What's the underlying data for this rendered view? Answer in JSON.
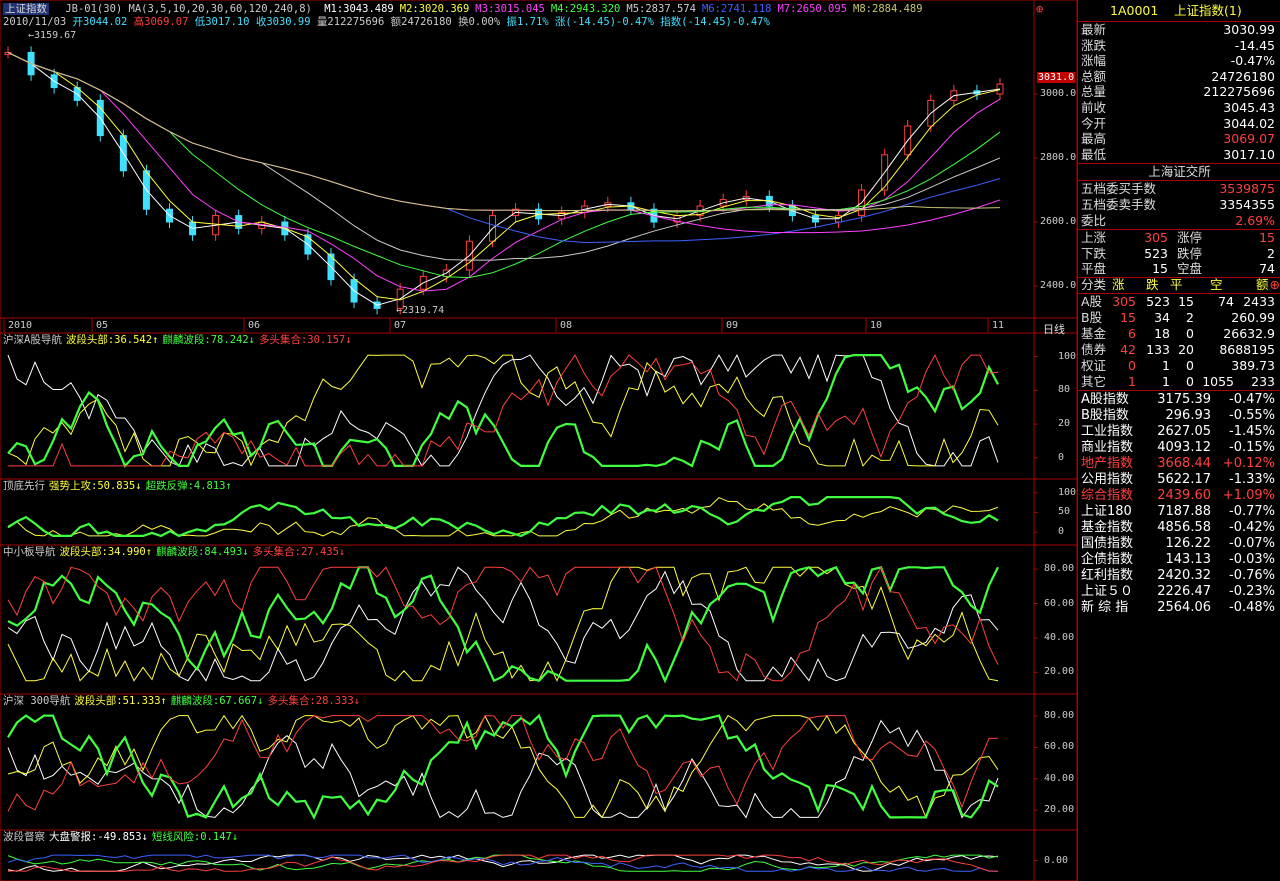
{
  "window": {
    "title_left": "上证指数",
    "indicator_line": "JB-01(30) MA(3,5,10,20,30,60,120,240,8)",
    "ma_values": [
      {
        "label": "M1:3043.489",
        "color": "#ffffff"
      },
      {
        "label": "M2:3020.369",
        "color": "#ffff40"
      },
      {
        "label": "M3:3015.045",
        "color": "#ff40ff"
      },
      {
        "label": "M4:2943.320",
        "color": "#40ff40"
      },
      {
        "label": "M5:2837.574",
        "color": "#cccccc"
      },
      {
        "label": "M6:2741.118",
        "color": "#4060ff"
      },
      {
        "label": "M7:2650.095",
        "color": "#ff40ff"
      },
      {
        "label": "M8:2884.489",
        "color": "#c8c870"
      }
    ],
    "date": "2010/11/03",
    "ohlc": {
      "open": "开3044.02",
      "high": "高3069.07",
      "low": "低3017.10",
      "close": "收3030.99",
      "vol": "量212275696",
      "amount": "额24726180",
      "turnover": "换0.00%",
      "amplitude": "振1.71%",
      "change": "涨(-14.45)-0.47%",
      "index_change": "指数(-14.45)-0.47%"
    },
    "high_label": "3159.67",
    "low_label": "2319.74",
    "current_price_tag": "3031.0",
    "period_label": "日线"
  },
  "price_axis": [
    "3000.0",
    "2800.0",
    "2600.0",
    "2400.0"
  ],
  "time_axis": [
    "2010",
    "05",
    "06",
    "07",
    "08",
    "09",
    "10",
    "11"
  ],
  "panels": [
    {
      "name": "沪深A股导航",
      "items": [
        {
          "t": "波段头部:36.542↑",
          "c": "#ffff40"
        },
        {
          "t": "麒麟波段:78.242↓",
          "c": "#40ff40"
        },
        {
          "t": "多头集合:30.157↓",
          "c": "#ff4040"
        }
      ],
      "axis": [
        "100",
        "80",
        "20",
        "0"
      ]
    },
    {
      "name": "顶底先行",
      "items": [
        {
          "t": "强势上攻:50.835↓",
          "c": "#ffff40"
        },
        {
          "t": "超跌反弹:4.813↑",
          "c": "#40ff40"
        }
      ],
      "axis": [
        "100",
        "50",
        "0"
      ]
    },
    {
      "name": "中小板导航",
      "items": [
        {
          "t": "波段头部:34.990↑",
          "c": "#ffff40"
        },
        {
          "t": "麒麟波段:84.493↓",
          "c": "#40ff40"
        },
        {
          "t": "多头集合:27.435↓",
          "c": "#ff4040"
        }
      ],
      "axis": [
        "80.00",
        "60.00",
        "40.00",
        "20.00"
      ]
    },
    {
      "name": "沪深 300导航",
      "items": [
        {
          "t": "波段头部:51.333↑",
          "c": "#ffff40"
        },
        {
          "t": "麒麟波段:67.667↓",
          "c": "#40ff40"
        },
        {
          "t": "多头集合:28.333↓",
          "c": "#ff4040"
        }
      ],
      "axis": [
        "80.00",
        "60.00",
        "40.00",
        "20.00"
      ]
    },
    {
      "name": "波段督察",
      "items": [
        {
          "t": "大盘警报:-49.853↓",
          "c": "#ffffff"
        },
        {
          "t": "短线风险:0.147↓",
          "c": "#40ff40"
        }
      ],
      "axis": [
        "0.00"
      ]
    }
  ],
  "quote": {
    "code": "1A0001",
    "name": "上证指数(1)",
    "rows": [
      {
        "k": "最新",
        "v": "3030.99",
        "c": "wht"
      },
      {
        "k": "涨跌",
        "v": "-14.45",
        "c": "wht"
      },
      {
        "k": "涨幅",
        "v": "-0.47%",
        "c": "wht"
      },
      {
        "k": "总额",
        "v": "24726180",
        "c": "wht"
      },
      {
        "k": "总量",
        "v": "212275696",
        "c": "wht"
      },
      {
        "k": "前收",
        "v": "3045.43",
        "c": "wht"
      },
      {
        "k": "今开",
        "v": "3044.02",
        "c": "wht"
      },
      {
        "k": "最高",
        "v": "3069.07",
        "c": "red"
      },
      {
        "k": "最低",
        "v": "3017.10",
        "c": "wht"
      }
    ],
    "exchange": "上海证交所",
    "order_rows": [
      {
        "k": "五档委买手数",
        "v": "3539875",
        "c": "red"
      },
      {
        "k": "五档委卖手数",
        "v": "3354355",
        "c": "wht"
      },
      {
        "k": "委比",
        "v": "2.69%",
        "c": "red"
      }
    ],
    "breadth": [
      {
        "a": "上涨",
        "av": "305",
        "b": "涨停",
        "bv": "15",
        "ac": "red",
        "bc": "red"
      },
      {
        "a": "下跌",
        "av": "523",
        "b": "跌停",
        "bv": "2",
        "ac": "wht",
        "bc": "wht"
      },
      {
        "a": "平盘",
        "av": "15",
        "b": "空盘",
        "bv": "74",
        "ac": "wht",
        "bc": "wht"
      }
    ],
    "cat_header": [
      "分类",
      "涨",
      "跌",
      "平",
      "空",
      "额"
    ],
    "cat_rows": [
      {
        "n": "A股",
        "u": "305",
        "d": "523",
        "f": "15",
        "e": "74",
        "amt": "2433"
      },
      {
        "n": "B股",
        "u": "15",
        "d": "34",
        "f": "2",
        "e": "",
        "amt": "260.99"
      },
      {
        "n": "基金",
        "u": "6",
        "d": "18",
        "f": "0",
        "e": "",
        "amt": "26632.9"
      },
      {
        "n": "债券",
        "u": "42",
        "d": "133",
        "f": "20",
        "e": "",
        "amt": "8688195"
      },
      {
        "n": "权证",
        "u": "0",
        "d": "1",
        "f": "0",
        "e": "",
        "amt": "389.73"
      },
      {
        "n": "其它",
        "u": "1",
        "d": "1",
        "f": "0",
        "e": "1055",
        "amt": "233"
      }
    ],
    "indices": [
      {
        "n": "A股指数",
        "v": "3175.39",
        "p": "-0.47%",
        "c": "wht"
      },
      {
        "n": "B股指数",
        "v": "296.93",
        "p": "-0.55%",
        "c": "wht"
      },
      {
        "n": "工业指数",
        "v": "2627.05",
        "p": "-1.45%",
        "c": "wht"
      },
      {
        "n": "商业指数",
        "v": "4093.12",
        "p": "-0.15%",
        "c": "wht"
      },
      {
        "n": "地产指数",
        "v": "3668.44",
        "p": "+0.12%",
        "c": "red"
      },
      {
        "n": "公用指数",
        "v": "5622.17",
        "p": "-1.33%",
        "c": "wht"
      },
      {
        "n": "综合指数",
        "v": "2439.60",
        "p": "+1.09%",
        "c": "red"
      },
      {
        "n": "上证180",
        "v": "7187.88",
        "p": "-0.77%",
        "c": "wht"
      },
      {
        "n": "基金指数",
        "v": "4856.58",
        "p": "-0.42%",
        "c": "wht"
      },
      {
        "n": "国债指数",
        "v": "126.22",
        "p": "-0.07%",
        "c": "wht"
      },
      {
        "n": "企债指数",
        "v": "143.13",
        "p": "-0.03%",
        "c": "wht"
      },
      {
        "n": "红利指数",
        "v": "2420.32",
        "p": "-0.76%",
        "c": "wht"
      },
      {
        "n": "上证５０",
        "v": "2226.47",
        "p": "-0.23%",
        "c": "wht"
      },
      {
        "n": "新 综 指",
        "v": "2564.06",
        "p": "-0.48%",
        "c": "wht"
      }
    ]
  },
  "chart_data": {
    "type": "line",
    "title": "上证指数",
    "x": [
      "2010",
      "05",
      "06",
      "07",
      "08",
      "09",
      "10",
      "11"
    ],
    "close_series": [
      3130,
      3060,
      3020,
      2980,
      2870,
      2760,
      2640,
      2600,
      2560,
      2620,
      2580,
      2600,
      2560,
      2500,
      2420,
      2350,
      2330,
      2390,
      2430,
      2450,
      2540,
      2620,
      2640,
      2610,
      2630,
      2650,
      2660,
      2640,
      2600,
      2620,
      2650,
      2670,
      2680,
      2650,
      2620,
      2600,
      2620,
      2700,
      2810,
      2900,
      2980,
      3010,
      3000,
      3031
    ],
    "ylim": [
      2300,
      3200
    ]
  }
}
